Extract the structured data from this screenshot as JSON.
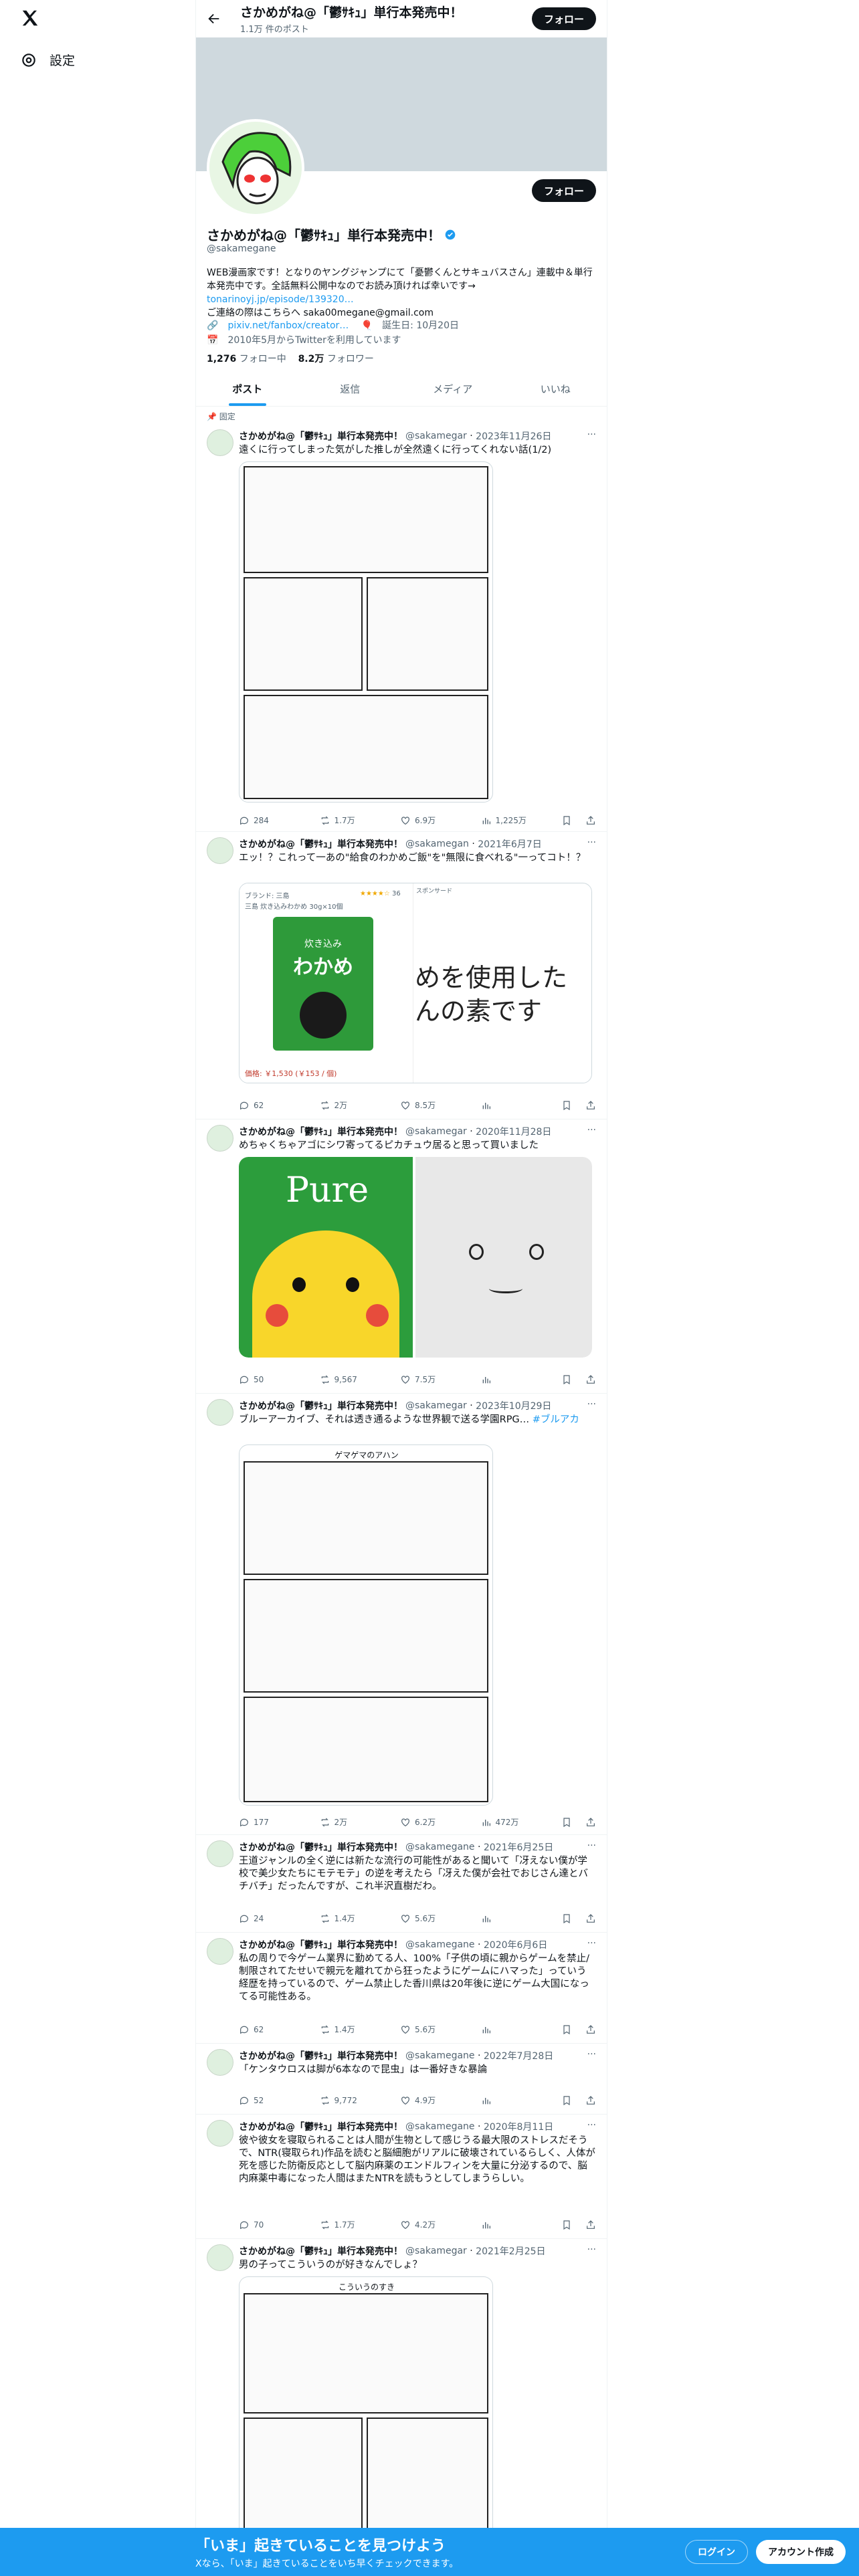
{
  "nav": {
    "settings_label": "設定"
  },
  "topbar": {
    "name": "さかめがね@「鬱ｻｷｭ」単行本発売中！",
    "post_count": "1.1万 件のポスト",
    "follow_label": "フォロー"
  },
  "profile": {
    "name": "さかめがね@「鬱ｻｷｭ」単行本発売中！",
    "handle": "@sakamegane",
    "bio_1": "WEB漫画家です！となりのヤングジャンプにて「憂鬱くんとサキュバスさん」連載中＆単行本発売中です。全話無料公開中なのでお読み頂ければ幸いです→",
    "bio_link": "tonarinoyj.jp/episode/139320…",
    "bio_2": "ご連絡の際はこちらへ saka00megane@gmail.com",
    "website": "pixiv.net/fanbox/creator…",
    "birthday": "誕生日: 10月20日",
    "joined": "2010年5月からTwitterを利用しています",
    "following_count": "1,276",
    "following_label": "フォロー中",
    "followers_count": "8.2万",
    "followers_label": "フォロワー"
  },
  "tabs": [
    "ポスト",
    "返信",
    "メディア",
    "いいね"
  ],
  "pinned_label": "固定",
  "tweets": [
    {
      "name": "さかめがね@「鬱ｻｷｭ」単行本発売中！",
      "handle": "@sakamegar",
      "date": "2023年11月26日",
      "text": "遠くに行ってしまった気がした推しが全然遠くに行ってくれない話(1/2)",
      "reply": "284",
      "retweet": "1.7万",
      "like": "6.9万",
      "views": "1,225万"
    },
    {
      "name": "さかめがね@「鬱ｻｷｭ」単行本発売中！",
      "handle": "@sakamegan",
      "date": "2021年6月7日",
      "text": "エッ！？これって一あの\"給食のわかめご飯\"を\"無限に食べれる\"一ってコト！？",
      "reply": "62",
      "retweet": "2万",
      "like": "8.5万",
      "views": "",
      "card": {
        "brand": "ブランド: 三島",
        "stars_label": "スポンサード",
        "reviews": "36",
        "product_title": "三島 炊き込みわかめ 30g×10個",
        "product_big": "わかめ",
        "product_small": "炊き込み",
        "side_text": "めを使用した",
        "side_text_2": "んの素です",
        "price": "価格: ￥1,530 (￥153 / 個)"
      }
    },
    {
      "name": "さかめがね@「鬱ｻｷｭ」単行本発売中！",
      "handle": "@sakamegar",
      "date": "2020年11月28日",
      "text": "めちゃくちゃアゴにシワ寄ってるピカチュウ居ると思って買いました",
      "reply": "50",
      "retweet": "9,567",
      "like": "7.5万",
      "views": "",
      "pure_label": "Pure"
    },
    {
      "name": "さかめがね@「鬱ｻｷｭ」単行本発売中！",
      "handle": "@sakamegar",
      "date": "2023年10月29日",
      "text": "ブルーアーカイブ、それは透き通るような世界観で送る学園RPG…",
      "tag": "#ブルアカ",
      "reply": "177",
      "retweet": "2万",
      "like": "6.2万",
      "views": "472万",
      "manga_title": "ゲマゲマのアハン"
    },
    {
      "name": "さかめがね@「鬱ｻｷｭ」単行本発売中！",
      "handle": "@sakamegane",
      "date": "2021年6月25日",
      "text": "王道ジャンルの全く逆には新たな流行の可能性があると聞いて「冴えない僕が学校で美少女たちにモテモテ」の逆を考えたら「冴えた僕が会社でおじさん達とバチバチ」だったんですが、これ半沢直樹だわ。",
      "reply": "24",
      "retweet": "1.4万",
      "like": "5.6万",
      "views": ""
    },
    {
      "name": "さかめがね@「鬱ｻｷｭ」単行本発売中！",
      "handle": "@sakamegane",
      "date": "2020年6月6日",
      "text": "私の周りで今ゲーム業界に勤めてる人、100%「子供の頃に親からゲームを禁止/制限されてたせいで親元を離れてから狂ったようにゲームにハマった」っていう経歴を持っているので、ゲーム禁止した香川県は20年後に逆にゲーム大国になってる可能性ある。",
      "reply": "62",
      "retweet": "1.4万",
      "like": "5.6万",
      "views": ""
    },
    {
      "name": "さかめがね@「鬱ｻｷｭ」単行本発売中！",
      "handle": "@sakamegane",
      "date": "2022年7月28日",
      "text": "「ケンタウロスは脚が6本なので昆虫」は一番好きな暴論",
      "reply": "52",
      "retweet": "9,772",
      "like": "4.9万",
      "views": ""
    },
    {
      "name": "さかめがね@「鬱ｻｷｭ」単行本発売中！",
      "handle": "@sakamegane",
      "date": "2020年8月11日",
      "text": "彼や彼女を寝取られることは人間が生物として感じうる最大限のストレスだそうで、NTR(寝取られ)作品を読むと脳細胞がリアルに破壊されているらしく、人体が死を感じた防衛反応として脳内麻薬のエンドルフィンを大量に分泌するので、脳内麻薬中毒になった人間はまたNTRを読もうとしてしまうらしい。",
      "reply": "70",
      "retweet": "1.7万",
      "like": "4.2万",
      "views": ""
    },
    {
      "name": "さかめがね@「鬱ｻｷｭ」単行本発売中！",
      "handle": "@sakamegar",
      "date": "2021年2月25日",
      "text": "男の子ってこういうのが好きなんでしょ？",
      "reply": "",
      "retweet": "",
      "like": "",
      "views": "",
      "manga_title": "こういうのすき"
    }
  ],
  "bottom": {
    "title": "「いま」起きていることを見つけよう",
    "subtitle": "Xなら、「いま」起きていることをいち早くチェックできます。",
    "login": "ログイン",
    "signup": "アカウント作成"
  },
  "colors": {
    "accent": "#1d9bf0",
    "text": "#0f1419",
    "muted": "#536471",
    "banner": "#cfd9de"
  }
}
